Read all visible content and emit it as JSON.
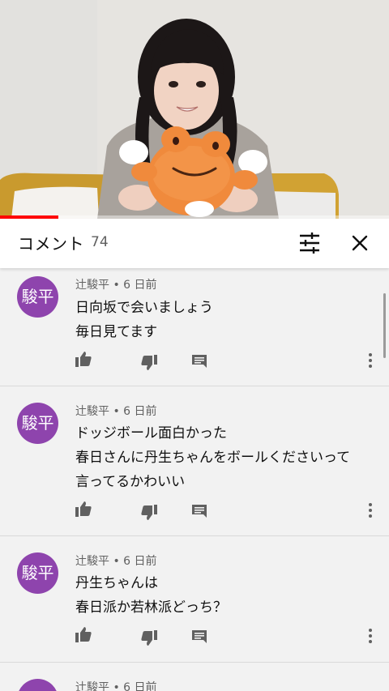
{
  "video": {
    "progress_fraction": 0.15
  },
  "header": {
    "title": "コメント",
    "count": "74"
  },
  "icons": {
    "filter": "tune-icon",
    "close": "close-icon",
    "like": "thumb-up-icon",
    "dislike": "thumb-down-icon",
    "reply": "comment-icon",
    "more": "more-vert-icon"
  },
  "colors": {
    "avatar": "#8e44ad",
    "progress": "#ff0000"
  },
  "comments": [
    {
      "avatar_text": "駿平",
      "meta": "辻駿平 • 6 日前",
      "lines": [
        "日向坂で会いましょう",
        "毎日見てます"
      ]
    },
    {
      "avatar_text": "駿平",
      "meta": "辻駿平 • 6 日前",
      "lines": [
        "ドッジボール面白かった",
        "春日さんに丹生ちゃんをボールくださいって",
        "言ってるかわいい"
      ]
    },
    {
      "avatar_text": "駿平",
      "meta": "辻駿平 • 6 日前",
      "lines": [
        "丹生ちゃんは",
        "春日派か若林派どっち？"
      ]
    },
    {
      "avatar_text": "駿平",
      "meta": "辻駿平 • 6 日前",
      "lines": []
    }
  ]
}
